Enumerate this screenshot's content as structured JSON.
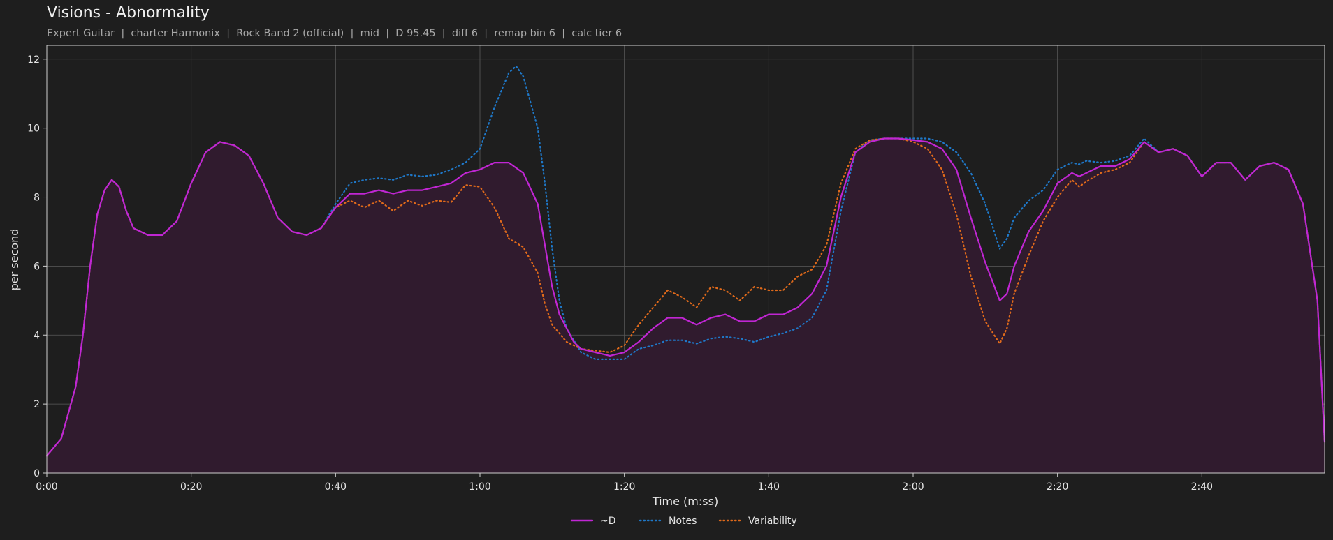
{
  "header": {
    "title": "Visions - Abnormality",
    "subtitle": "Expert Guitar  |  charter Harmonix  |  Rock Band 2 (official)  |  mid  |  D 95.45  |  diff 6  |  remap bin 6  |  calc tier 6"
  },
  "colors": {
    "background": "#1e1e1e",
    "axis": "#cfcfcf",
    "grid": "#5a5a5a",
    "d_series": "#c026d3",
    "d_fill": "#301b2e",
    "notes_series": "#1f78c8",
    "variability_series": "#e06a1b"
  },
  "chart_data": {
    "type": "line",
    "title": "Visions - Abnormality",
    "xlabel": "Time (m:ss)",
    "ylabel": "per second",
    "xlim": [
      0,
      177
    ],
    "ylim": [
      0,
      12.4
    ],
    "x_ticks": [
      0,
      20,
      40,
      60,
      80,
      100,
      120,
      140,
      160
    ],
    "x_tick_labels": [
      "0:00",
      "0:20",
      "0:40",
      "1:00",
      "1:20",
      "1:40",
      "2:00",
      "2:20",
      "2:40"
    ],
    "y_ticks": [
      0,
      2,
      4,
      6,
      8,
      10,
      12
    ],
    "y_tick_labels": [
      "0",
      "2",
      "4",
      "6",
      "8",
      "10",
      "12"
    ],
    "grid": true,
    "legend_position": "bottom-center",
    "series": [
      {
        "name": "~D",
        "style": "solid",
        "filled": true,
        "points": [
          [
            0,
            0.5
          ],
          [
            2,
            1.0
          ],
          [
            4,
            2.5
          ],
          [
            5,
            4.0
          ],
          [
            6,
            6.0
          ],
          [
            7,
            7.5
          ],
          [
            8,
            8.2
          ],
          [
            9,
            8.5
          ],
          [
            10,
            8.3
          ],
          [
            11,
            7.6
          ],
          [
            12,
            7.1
          ],
          [
            14,
            6.9
          ],
          [
            16,
            6.9
          ],
          [
            18,
            7.3
          ],
          [
            20,
            8.4
          ],
          [
            22,
            9.3
          ],
          [
            24,
            9.6
          ],
          [
            26,
            9.5
          ],
          [
            28,
            9.2
          ],
          [
            30,
            8.4
          ],
          [
            32,
            7.4
          ],
          [
            34,
            7.0
          ],
          [
            36,
            6.9
          ],
          [
            38,
            7.1
          ],
          [
            40,
            7.7
          ],
          [
            42,
            8.1
          ],
          [
            44,
            8.1
          ],
          [
            46,
            8.2
          ],
          [
            48,
            8.1
          ],
          [
            50,
            8.2
          ],
          [
            52,
            8.2
          ],
          [
            54,
            8.3
          ],
          [
            56,
            8.4
          ],
          [
            58,
            8.7
          ],
          [
            60,
            8.8
          ],
          [
            62,
            9.0
          ],
          [
            64,
            9.0
          ],
          [
            66,
            8.7
          ],
          [
            68,
            7.8
          ],
          [
            69,
            6.6
          ],
          [
            70,
            5.4
          ],
          [
            71,
            4.6
          ],
          [
            72,
            4.2
          ],
          [
            73,
            3.8
          ],
          [
            74,
            3.6
          ],
          [
            76,
            3.5
          ],
          [
            78,
            3.4
          ],
          [
            80,
            3.5
          ],
          [
            82,
            3.8
          ],
          [
            84,
            4.2
          ],
          [
            86,
            4.5
          ],
          [
            88,
            4.5
          ],
          [
            90,
            4.3
          ],
          [
            92,
            4.5
          ],
          [
            94,
            4.6
          ],
          [
            96,
            4.4
          ],
          [
            98,
            4.4
          ],
          [
            100,
            4.6
          ],
          [
            102,
            4.6
          ],
          [
            104,
            4.8
          ],
          [
            106,
            5.2
          ],
          [
            108,
            6.0
          ],
          [
            110,
            8.0
          ],
          [
            112,
            9.3
          ],
          [
            114,
            9.6
          ],
          [
            116,
            9.7
          ],
          [
            118,
            9.7
          ],
          [
            120,
            9.65
          ],
          [
            122,
            9.6
          ],
          [
            124,
            9.4
          ],
          [
            126,
            8.8
          ],
          [
            128,
            7.4
          ],
          [
            130,
            6.1
          ],
          [
            132,
            5.0
          ],
          [
            133,
            5.2
          ],
          [
            134,
            6.0
          ],
          [
            136,
            7.0
          ],
          [
            138,
            7.6
          ],
          [
            140,
            8.4
          ],
          [
            142,
            8.7
          ],
          [
            143,
            8.6
          ],
          [
            144,
            8.7
          ],
          [
            146,
            8.9
          ],
          [
            148,
            8.9
          ],
          [
            150,
            9.1
          ],
          [
            152,
            9.6
          ],
          [
            154,
            9.3
          ],
          [
            156,
            9.4
          ],
          [
            158,
            9.2
          ],
          [
            160,
            8.6
          ],
          [
            162,
            9.0
          ],
          [
            164,
            9.0
          ],
          [
            166,
            8.5
          ],
          [
            168,
            8.9
          ],
          [
            170,
            9.0
          ],
          [
            172,
            8.8
          ],
          [
            174,
            7.8
          ],
          [
            176,
            5.0
          ],
          [
            177,
            0.9
          ]
        ]
      },
      {
        "name": "Notes",
        "style": "dotted",
        "filled": false,
        "points": [
          [
            0,
            0.5
          ],
          [
            2,
            1.0
          ],
          [
            4,
            2.5
          ],
          [
            5,
            4.0
          ],
          [
            6,
            6.0
          ],
          [
            7,
            7.5
          ],
          [
            8,
            8.2
          ],
          [
            9,
            8.5
          ],
          [
            10,
            8.3
          ],
          [
            11,
            7.6
          ],
          [
            12,
            7.1
          ],
          [
            14,
            6.9
          ],
          [
            16,
            6.9
          ],
          [
            18,
            7.3
          ],
          [
            20,
            8.4
          ],
          [
            22,
            9.3
          ],
          [
            24,
            9.6
          ],
          [
            26,
            9.5
          ],
          [
            28,
            9.2
          ],
          [
            30,
            8.4
          ],
          [
            32,
            7.4
          ],
          [
            34,
            7.0
          ],
          [
            36,
            6.9
          ],
          [
            38,
            7.1
          ],
          [
            40,
            7.8
          ],
          [
            42,
            8.4
          ],
          [
            44,
            8.5
          ],
          [
            46,
            8.55
          ],
          [
            48,
            8.5
          ],
          [
            50,
            8.65
          ],
          [
            52,
            8.6
          ],
          [
            54,
            8.65
          ],
          [
            56,
            8.8
          ],
          [
            58,
            9.0
          ],
          [
            60,
            9.4
          ],
          [
            62,
            10.6
          ],
          [
            64,
            11.6
          ],
          [
            65,
            11.8
          ],
          [
            66,
            11.5
          ],
          [
            68,
            10.0
          ],
          [
            69,
            8.4
          ],
          [
            70,
            6.5
          ],
          [
            71,
            5.0
          ],
          [
            72,
            4.2
          ],
          [
            74,
            3.5
          ],
          [
            76,
            3.3
          ],
          [
            78,
            3.3
          ],
          [
            80,
            3.3
          ],
          [
            82,
            3.6
          ],
          [
            84,
            3.7
          ],
          [
            86,
            3.85
          ],
          [
            88,
            3.85
          ],
          [
            90,
            3.75
          ],
          [
            92,
            3.9
          ],
          [
            94,
            3.95
          ],
          [
            96,
            3.9
          ],
          [
            98,
            3.8
          ],
          [
            100,
            3.95
          ],
          [
            102,
            4.05
          ],
          [
            104,
            4.2
          ],
          [
            106,
            4.5
          ],
          [
            108,
            5.3
          ],
          [
            110,
            7.6
          ],
          [
            112,
            9.3
          ],
          [
            114,
            9.65
          ],
          [
            116,
            9.7
          ],
          [
            118,
            9.7
          ],
          [
            120,
            9.7
          ],
          [
            122,
            9.7
          ],
          [
            124,
            9.6
          ],
          [
            126,
            9.3
          ],
          [
            128,
            8.7
          ],
          [
            130,
            7.8
          ],
          [
            132,
            6.5
          ],
          [
            133,
            6.8
          ],
          [
            134,
            7.4
          ],
          [
            136,
            7.9
          ],
          [
            138,
            8.2
          ],
          [
            140,
            8.8
          ],
          [
            142,
            9.0
          ],
          [
            143,
            8.95
          ],
          [
            144,
            9.05
          ],
          [
            146,
            9.0
          ],
          [
            148,
            9.05
          ],
          [
            150,
            9.2
          ],
          [
            152,
            9.7
          ],
          [
            154,
            9.3
          ],
          [
            156,
            9.4
          ],
          [
            158,
            9.2
          ],
          [
            160,
            8.6
          ],
          [
            162,
            9.0
          ],
          [
            164,
            9.0
          ],
          [
            166,
            8.5
          ],
          [
            168,
            8.9
          ],
          [
            170,
            9.0
          ],
          [
            172,
            8.8
          ],
          [
            174,
            7.8
          ],
          [
            176,
            5.0
          ],
          [
            177,
            0.9
          ]
        ]
      },
      {
        "name": "Variability",
        "style": "dotted",
        "filled": false,
        "points": [
          [
            0,
            0.5
          ],
          [
            2,
            1.0
          ],
          [
            4,
            2.5
          ],
          [
            5,
            4.0
          ],
          [
            6,
            6.0
          ],
          [
            7,
            7.5
          ],
          [
            8,
            8.2
          ],
          [
            9,
            8.5
          ],
          [
            10,
            8.3
          ],
          [
            11,
            7.6
          ],
          [
            12,
            7.1
          ],
          [
            14,
            6.9
          ],
          [
            16,
            6.9
          ],
          [
            18,
            7.3
          ],
          [
            20,
            8.4
          ],
          [
            22,
            9.3
          ],
          [
            24,
            9.6
          ],
          [
            26,
            9.5
          ],
          [
            28,
            9.2
          ],
          [
            30,
            8.4
          ],
          [
            32,
            7.4
          ],
          [
            34,
            7.0
          ],
          [
            36,
            6.9
          ],
          [
            38,
            7.1
          ],
          [
            40,
            7.7
          ],
          [
            42,
            7.9
          ],
          [
            44,
            7.7
          ],
          [
            46,
            7.9
          ],
          [
            48,
            7.6
          ],
          [
            50,
            7.9
          ],
          [
            52,
            7.75
          ],
          [
            54,
            7.9
          ],
          [
            56,
            7.85
          ],
          [
            58,
            8.35
          ],
          [
            60,
            8.3
          ],
          [
            62,
            7.7
          ],
          [
            64,
            6.8
          ],
          [
            66,
            6.55
          ],
          [
            68,
            5.8
          ],
          [
            69,
            4.9
          ],
          [
            70,
            4.3
          ],
          [
            72,
            3.8
          ],
          [
            74,
            3.6
          ],
          [
            76,
            3.55
          ],
          [
            78,
            3.5
          ],
          [
            80,
            3.7
          ],
          [
            82,
            4.3
          ],
          [
            84,
            4.8
          ],
          [
            86,
            5.3
          ],
          [
            88,
            5.1
          ],
          [
            90,
            4.8
          ],
          [
            92,
            5.4
          ],
          [
            94,
            5.3
          ],
          [
            96,
            5.0
          ],
          [
            98,
            5.4
          ],
          [
            100,
            5.3
          ],
          [
            102,
            5.3
          ],
          [
            104,
            5.7
          ],
          [
            106,
            5.9
          ],
          [
            108,
            6.6
          ],
          [
            110,
            8.4
          ],
          [
            112,
            9.4
          ],
          [
            114,
            9.65
          ],
          [
            116,
            9.7
          ],
          [
            118,
            9.7
          ],
          [
            120,
            9.6
          ],
          [
            122,
            9.4
          ],
          [
            124,
            8.8
          ],
          [
            126,
            7.5
          ],
          [
            128,
            5.7
          ],
          [
            130,
            4.4
          ],
          [
            132,
            3.75
          ],
          [
            133,
            4.2
          ],
          [
            134,
            5.2
          ],
          [
            136,
            6.3
          ],
          [
            138,
            7.3
          ],
          [
            140,
            8.0
          ],
          [
            142,
            8.5
          ],
          [
            143,
            8.3
          ],
          [
            144,
            8.45
          ],
          [
            146,
            8.7
          ],
          [
            148,
            8.8
          ],
          [
            150,
            9.0
          ],
          [
            152,
            9.6
          ],
          [
            154,
            9.3
          ],
          [
            156,
            9.4
          ],
          [
            158,
            9.2
          ],
          [
            160,
            8.6
          ],
          [
            162,
            9.0
          ],
          [
            164,
            9.0
          ],
          [
            166,
            8.5
          ],
          [
            168,
            8.9
          ],
          [
            170,
            9.0
          ],
          [
            172,
            8.8
          ],
          [
            174,
            7.8
          ],
          [
            176,
            5.0
          ],
          [
            177,
            0.9
          ]
        ]
      }
    ]
  }
}
